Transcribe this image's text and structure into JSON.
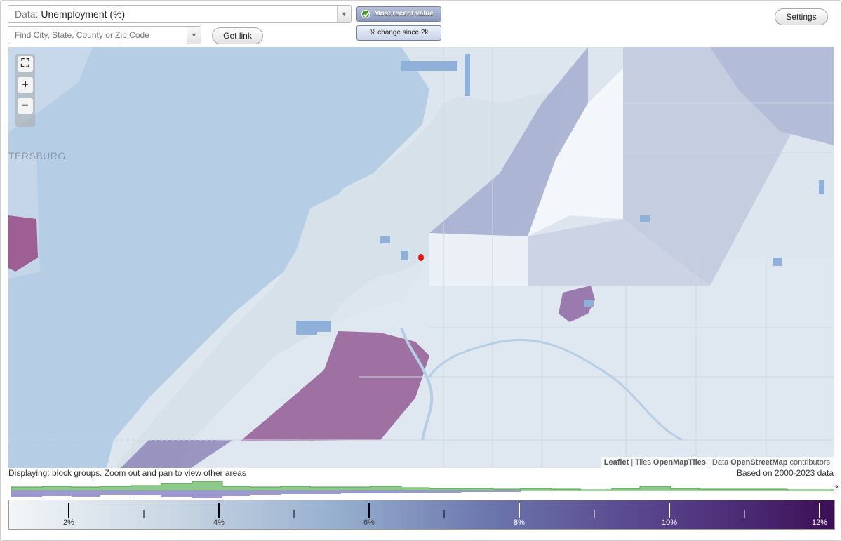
{
  "data_selector": {
    "prefix": "Data:",
    "value": "Unemployment (%)"
  },
  "search": {
    "placeholder": "Find City, State, County or Zip Code"
  },
  "buttons": {
    "get_link": "Get link",
    "settings": "Settings"
  },
  "mode": {
    "active": "Most recent value",
    "inactive": "% change since 2k"
  },
  "map": {
    "place_label": "TERSBURG",
    "zoom_controls": {
      "fullscreen": "⛶",
      "zoom_in": "+",
      "zoom_out": "−"
    },
    "attribution": {
      "leaflet": "Leaflet",
      "sep1": " | Tiles ",
      "tiles": "OpenMapTiles",
      "sep2": " | Data ",
      "data": "OpenStreetMap",
      "suffix": " contributors"
    }
  },
  "footer": {
    "display_note": "Displaying: block groups. Zoom out and pan to view other areas",
    "based_on": "Based on 2000-2023 data",
    "unknown_mark": "?"
  },
  "legend": {
    "ticks": [
      "2%",
      "4%",
      "6%",
      "8%",
      "10%",
      "12%"
    ]
  },
  "colors": {
    "water": "#b3cde6",
    "land": "#dbe5ee",
    "low": "#eef2f8",
    "mid": "#9ea8cc",
    "high": "#8f5d92",
    "hist_green": "#8cc98a",
    "hist_purple": "#9d97cf"
  }
}
